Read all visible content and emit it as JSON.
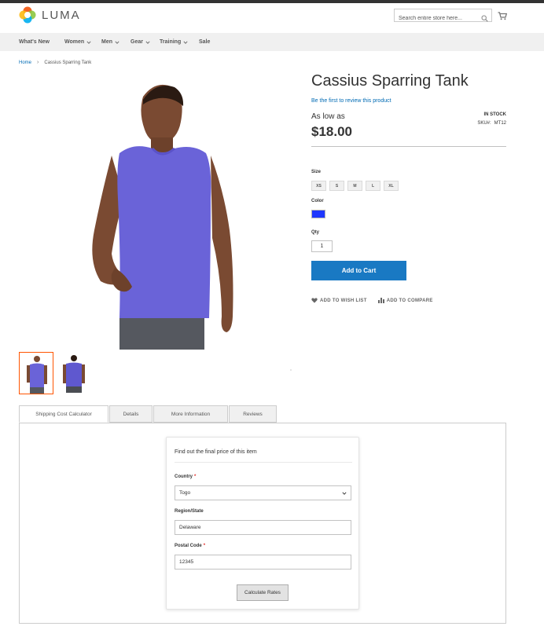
{
  "header": {
    "logo_text": "LUMA",
    "search_placeholder": "Search entire store here..."
  },
  "nav": {
    "items": [
      {
        "label": "What's New",
        "has_menu": false
      },
      {
        "label": "Women",
        "has_menu": true
      },
      {
        "label": "Men",
        "has_menu": true
      },
      {
        "label": "Gear",
        "has_menu": true
      },
      {
        "label": "Training",
        "has_menu": true
      },
      {
        "label": "Sale",
        "has_menu": false
      }
    ]
  },
  "breadcrumb": {
    "home": "Home",
    "separator": "›",
    "current": "Cassius Sparring Tank"
  },
  "product": {
    "title": "Cassius Sparring Tank",
    "review_link": "Be the first to review this product",
    "price_prefix": "As low as",
    "price": "$18.00",
    "stock": "IN STOCK",
    "sku_label": "SKU#:",
    "sku": "MT12",
    "size_label": "Size",
    "sizes": [
      "XS",
      "S",
      "M",
      "L",
      "XL"
    ],
    "color_label": "Color",
    "color_swatch": "#1f37ff",
    "qty_label": "Qty",
    "qty_value": "1",
    "add_to_cart": "Add to Cart",
    "wishlist": "ADD TO WISH LIST",
    "compare": "ADD TO COMPARE",
    "shirt_color": "#6a63d8"
  },
  "tabs": [
    {
      "label": "Shipping Cost Calculator",
      "active": true
    },
    {
      "label": "Details",
      "active": false
    },
    {
      "label": "More Information",
      "active": false
    },
    {
      "label": "Reviews",
      "active": false
    }
  ],
  "calculator": {
    "title": "Find out the final price of this item",
    "country_label": "Country",
    "country_value": "Togo",
    "region_label": "Region/State",
    "region_value": "Delaware",
    "postal_label": "Postal Code",
    "postal_value": "12345",
    "required_mark": "*",
    "button": "Calculate Rates"
  },
  "colors": {
    "accent": "#1979c3",
    "link": "#006bb4",
    "thumb_border": "#ff5501"
  }
}
